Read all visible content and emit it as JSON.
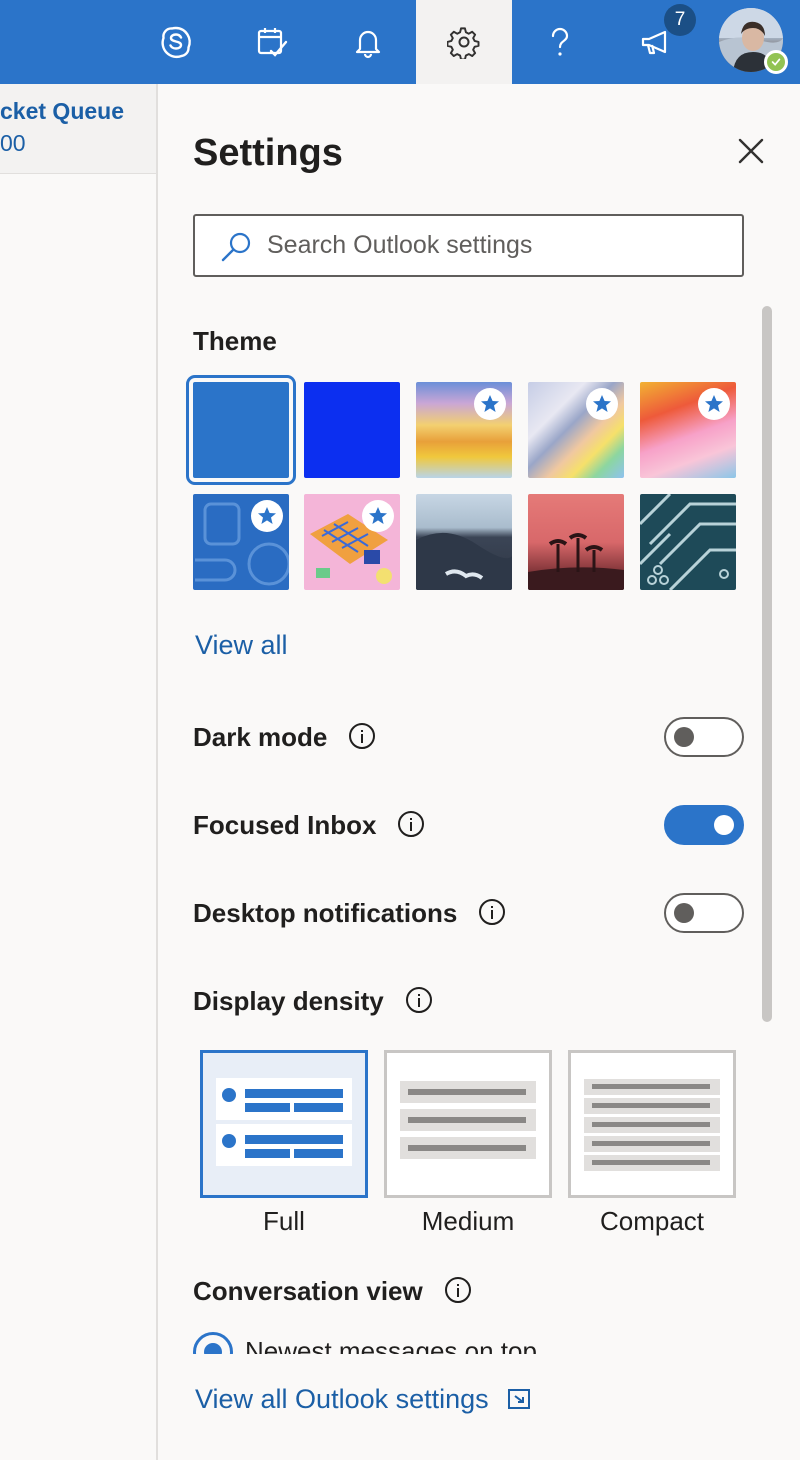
{
  "colors": {
    "brand_blue": "#2b74c9",
    "link_blue": "#1b5fa6",
    "panel_bg": "#faf9f8"
  },
  "topbar": {
    "items": [
      {
        "icon": "skype-icon"
      },
      {
        "icon": "calendar-check-icon"
      },
      {
        "icon": "bell-icon"
      },
      {
        "icon": "gear-icon",
        "active": true
      },
      {
        "icon": "help-icon"
      },
      {
        "icon": "megaphone-icon",
        "badge": "7"
      }
    ],
    "avatar_status": "online"
  },
  "left_pane": {
    "title": "cket Queue",
    "subtitle": "00"
  },
  "settings": {
    "title": "Settings",
    "search": {
      "placeholder": "Search Outlook settings"
    },
    "theme": {
      "label": "Theme",
      "view_all": "View all",
      "themes": [
        {
          "name": "Blue",
          "selected": true,
          "premium": false
        },
        {
          "name": "Bright blue",
          "selected": false,
          "premium": false
        },
        {
          "name": "Waves",
          "selected": false,
          "premium": true
        },
        {
          "name": "Ribbons",
          "selected": false,
          "premium": true
        },
        {
          "name": "Unicorn",
          "selected": false,
          "premium": true
        },
        {
          "name": "Sports",
          "selected": false,
          "premium": true
        },
        {
          "name": "Isometric",
          "selected": false,
          "premium": true
        },
        {
          "name": "Mountains",
          "selected": false,
          "premium": false
        },
        {
          "name": "Palms",
          "selected": false,
          "premium": false
        },
        {
          "name": "Circuit",
          "selected": false,
          "premium": false
        }
      ]
    },
    "toggles": {
      "dark_mode": {
        "label": "Dark mode",
        "on": false
      },
      "focused_inbox": {
        "label": "Focused Inbox",
        "on": true
      },
      "desktop_notifications": {
        "label": "Desktop notifications",
        "on": false
      }
    },
    "display_density": {
      "label": "Display density",
      "options": [
        {
          "label": "Full",
          "selected": true
        },
        {
          "label": "Medium",
          "selected": false
        },
        {
          "label": "Compact",
          "selected": false
        }
      ]
    },
    "conversation_view": {
      "label": "Conversation view",
      "option_label": "Newest messages on top"
    },
    "footer_link": "View all Outlook settings"
  }
}
